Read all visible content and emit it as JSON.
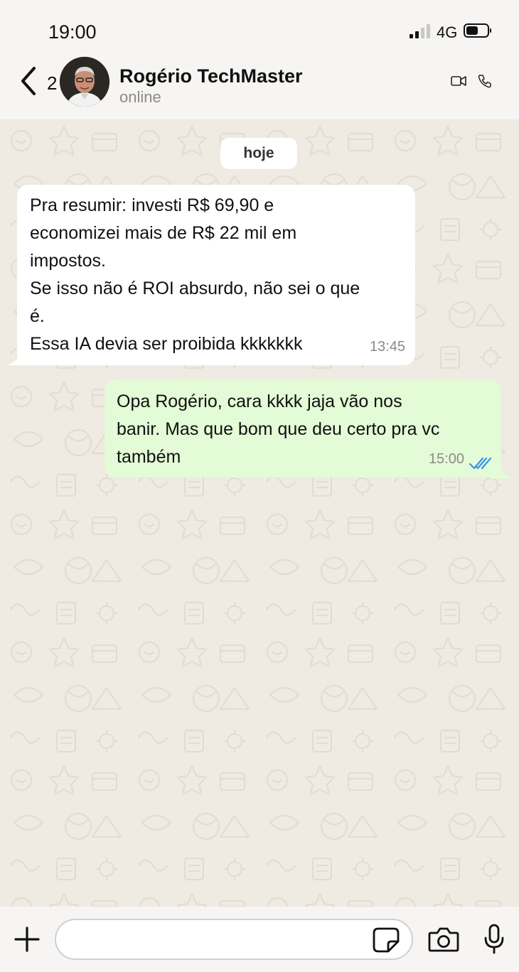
{
  "status_bar": {
    "time": "19:00",
    "network": "4G"
  },
  "header": {
    "back_count": "2",
    "contact_name": "Rogério TechMaster",
    "contact_status": "online"
  },
  "chat": {
    "date_chip": "hoje",
    "messages": [
      {
        "direction": "incoming",
        "lines": [
          "Pra resumir: investi R$ 69,90 e",
          "economizei mais de R$ 22 mil em",
          "impostos.",
          "Se isso não é ROI absurdo, não sei o que",
          "é.",
          "Essa IA devia ser proibida kkkkkkk"
        ],
        "time": "13:45"
      },
      {
        "direction": "outgoing",
        "lines": [
          "Opa Rogério, cara kkkk  jaja vão nos",
          "banir. Mas que bom que deu certo pra vc",
          "também"
        ],
        "time": "15:00",
        "status": "read"
      }
    ]
  },
  "composer": {
    "input_value": ""
  },
  "colors": {
    "outgoing_bubble": "#e3fbd6",
    "incoming_bubble": "#ffffff",
    "wallpaper": "#efeae2",
    "read_ticks": "#3a92e8"
  }
}
